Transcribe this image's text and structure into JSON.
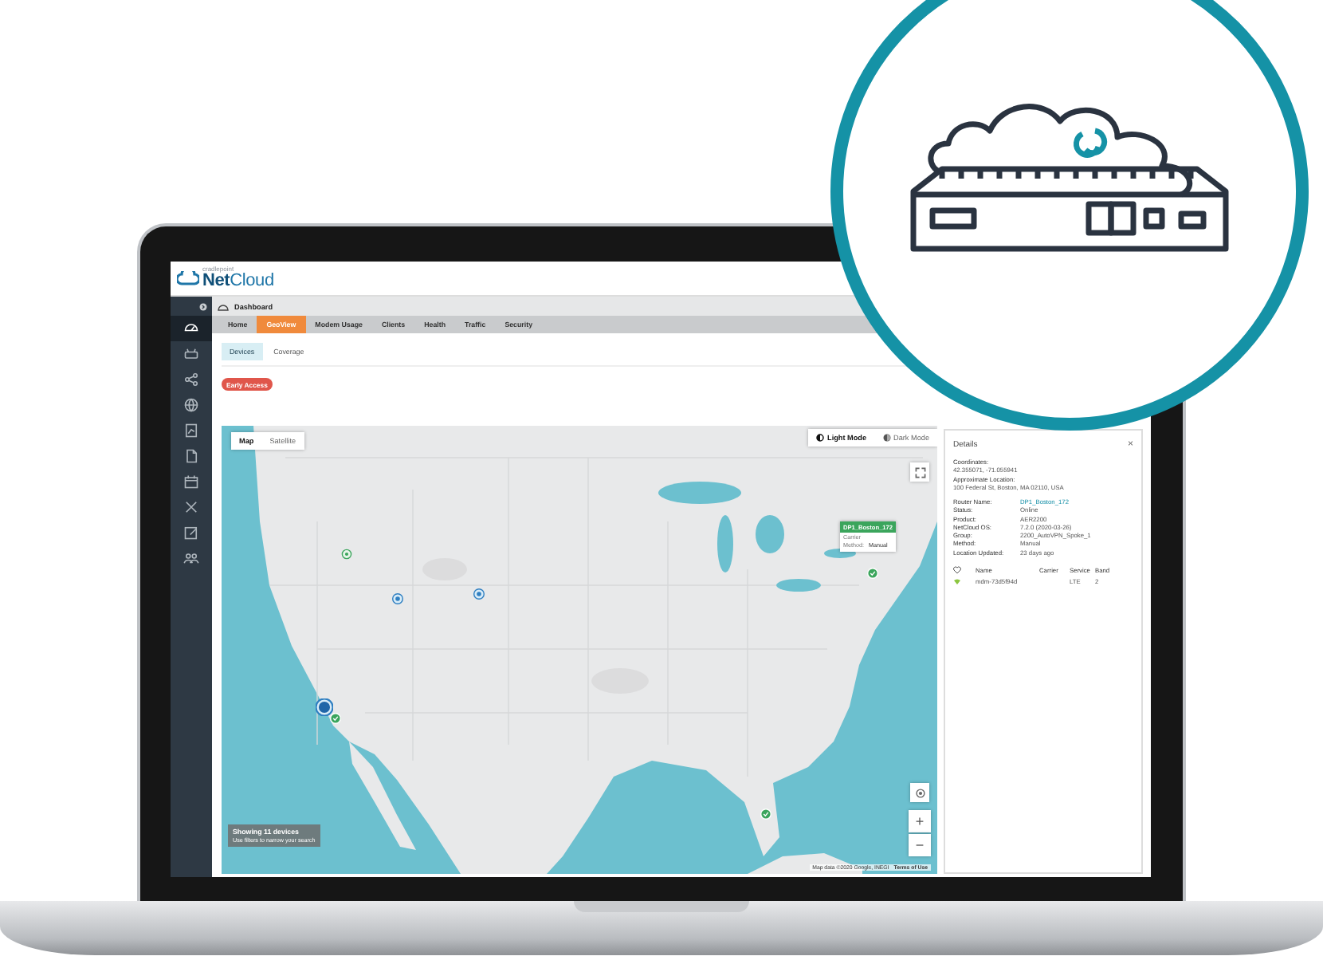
{
  "brand": {
    "company": "cradlepoint",
    "product": "**Net**Cloud"
  },
  "nav_icons": [
    {
      "selected": true
    },
    {
      "selected": false
    },
    {
      "selected": false
    },
    {
      "selected": false
    },
    {
      "selected": false
    },
    {
      "selected": false
    },
    {
      "selected": false
    },
    {
      "selected": false
    },
    {
      "selected": false
    },
    {
      "selected": false
    }
  ],
  "breadcrumb": "Dashboard",
  "tabs": [
    {
      "label": "Home",
      "selected": false
    },
    {
      "label": "GeoView",
      "selected": true
    },
    {
      "label": "Modem Usage",
      "selected": false
    },
    {
      "label": "Clients",
      "selected": false
    },
    {
      "label": "Health",
      "selected": false
    },
    {
      "label": "Traffic",
      "selected": false
    },
    {
      "label": "Security",
      "selected": false
    }
  ],
  "subtabs": [
    {
      "label": "Devices",
      "selected": true
    },
    {
      "label": "Coverage",
      "selected": false
    }
  ],
  "badge": "Early Access",
  "map": {
    "types": [
      {
        "label": "Map",
        "selected": true
      },
      {
        "label": "Satellite",
        "selected": false
      }
    ],
    "modes": [
      {
        "label": "Light Mode",
        "selected": true
      },
      {
        "label": "Dark Mode",
        "selected": false
      }
    ],
    "markers": [
      {
        "kind": "outline"
      },
      {
        "kind": "pin"
      },
      {
        "kind": "pin"
      },
      {
        "kind": "cluster"
      },
      {
        "kind": "check"
      },
      {
        "kind": "check"
      },
      {
        "kind": "check"
      }
    ],
    "popup": {
      "title": "DP1_Boston_172",
      "carrier_label": "Carrier",
      "method_label": "Method:",
      "method": "Manual"
    },
    "summary": {
      "title": "Showing 11 devices",
      "hint": "Use filters to narrow your search"
    },
    "attribution": "Map data ©2020 Google, INEGI",
    "terms": "Terms of Use",
    "zoom_in": "+",
    "zoom_out": "−"
  },
  "details": {
    "title": "Details",
    "close": "×",
    "location": [
      {
        "label": "Coordinates:",
        "value": "42.355071, -71.055941"
      },
      {
        "label": "Approximate Location:",
        "value": "100 Federal St, Boston, MA 02110, USA"
      }
    ],
    "fields": [
      {
        "label": "Router Name:",
        "value": "DP1_Boston_172",
        "kind": "link"
      },
      {
        "label": "Status:",
        "value": "Online",
        "kind": "text"
      },
      {
        "label": "Product:",
        "value": "AER2200",
        "kind": "text"
      },
      {
        "label": "NetCloud OS:",
        "value": "7.2.0 (2020-03-26)",
        "kind": "text"
      },
      {
        "label": "Group:",
        "value": "2200_AutoVPN_Spoke_1",
        "kind": "text"
      },
      {
        "label": "Method:",
        "value": "Manual",
        "kind": "text"
      },
      {
        "label": "Location Updated:",
        "value": "23 days ago",
        "kind": "text"
      }
    ],
    "columns": [
      "Name",
      "Carrier",
      "Service",
      "Band"
    ],
    "rows": [
      {
        "name": "mdm-73d5f94d",
        "service": "LTE",
        "band": "2"
      }
    ]
  }
}
